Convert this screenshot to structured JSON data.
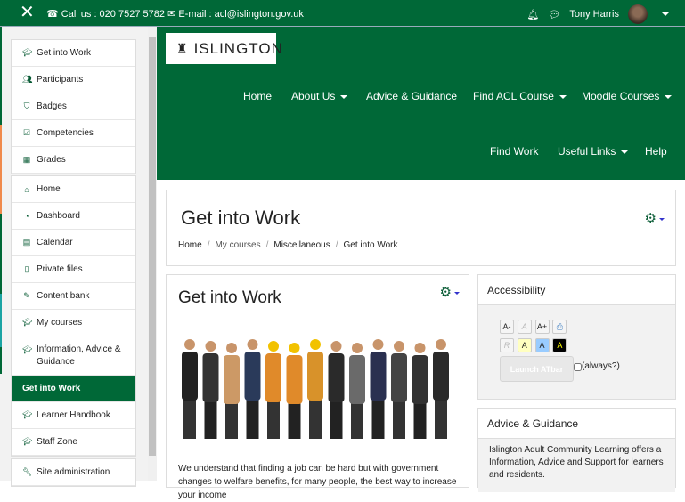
{
  "topbar": {
    "phone": "Call us : 020 7527 5782",
    "email": "E-mail : acl@islington.gov.uk",
    "user": "Tony Harris"
  },
  "sidebar": {
    "course_items": [
      {
        "label": "Get into Work",
        "icon": "graduation-cap"
      },
      {
        "label": "Participants",
        "icon": "users"
      },
      {
        "label": "Badges",
        "icon": "shield"
      },
      {
        "label": "Competencies",
        "icon": "check-square"
      },
      {
        "label": "Grades",
        "icon": "table"
      }
    ],
    "nav_items": [
      {
        "label": "Home",
        "icon": "home"
      },
      {
        "label": "Dashboard",
        "icon": "dashboard"
      },
      {
        "label": "Calendar",
        "icon": "calendar"
      },
      {
        "label": "Private files",
        "icon": "file"
      },
      {
        "label": "Content bank",
        "icon": "paintbrush"
      },
      {
        "label": "My courses",
        "icon": "graduation-cap"
      },
      {
        "label": "Information, Advice & Guidance",
        "icon": "graduation-cap"
      },
      {
        "label": "Get into Work",
        "icon": ""
      },
      {
        "label": "Learner Handbook",
        "icon": "graduation-cap"
      },
      {
        "label": "Staff Zone",
        "icon": "graduation-cap"
      }
    ],
    "admin": "Site administration"
  },
  "header": {
    "logo": "ISLINGTON",
    "nav": [
      "Home",
      "About Us",
      "Advice & Guidance",
      "Find ACL Course",
      "Moodle Courses",
      "Find Work",
      "Useful Links",
      "Help"
    ]
  },
  "page": {
    "title": "Get into Work",
    "breadcrumb": [
      "Home",
      "My courses",
      "Miscellaneous",
      "Get into Work"
    ]
  },
  "main": {
    "title": "Get into Work",
    "text": "We understand that finding a job can be hard but with government changes to welfare benefits, for many people, the best way to increase your income"
  },
  "accessibility": {
    "title": "Accessibility",
    "buttons": [
      "A-",
      "A",
      "A+",
      "R",
      "A",
      "A",
      "A"
    ],
    "launch": "Launch ATbar",
    "always": "(always?)"
  },
  "advice": {
    "title": "Advice & Guidance",
    "text": "Islington Adult Community Learning offers a Information, Advice and Support for learners and residents."
  },
  "colors": {
    "brand": "#006837"
  }
}
